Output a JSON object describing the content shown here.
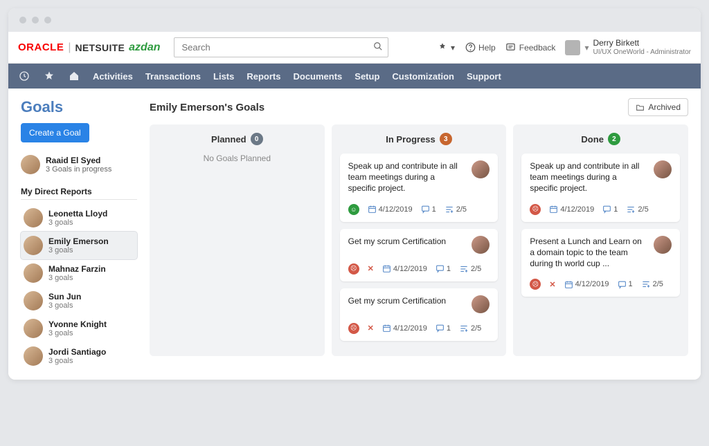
{
  "topbar": {
    "logo_oracle": "ORACLE",
    "logo_netsuite": "NETSUITE",
    "logo_azdan": "azdan",
    "search_placeholder": "Search",
    "help_label": "Help",
    "feedback_label": "Feedback",
    "user_name": "Derry Birkett",
    "user_role": "UI/UX OneWorld - Administrator"
  },
  "nav": {
    "items": [
      "Activities",
      "Transactions",
      "Lists",
      "Reports",
      "Documents",
      "Setup",
      "Customization",
      "Support"
    ]
  },
  "page": {
    "title": "Goals",
    "create_label": "Create a Goal",
    "me_name": "Raaid El Syed",
    "me_sub": "3 Goals in progress",
    "reports_header": "My Direct Reports",
    "reports": [
      {
        "name": "Leonetta Lloyd",
        "sub": "3 goals",
        "selected": false
      },
      {
        "name": "Emily Emerson",
        "sub": "3 goals",
        "selected": true
      },
      {
        "name": "Mahnaz Farzin",
        "sub": "3 goals",
        "selected": false
      },
      {
        "name": "Sun Jun",
        "sub": "3 goals",
        "selected": false
      },
      {
        "name": "Yvonne Knight",
        "sub": "3 goals",
        "selected": false
      },
      {
        "name": "Jordi Santiago",
        "sub": "3 goals",
        "selected": false
      }
    ],
    "selected_title": "Emily Emerson's Goals",
    "archived_label": "Archived"
  },
  "board": {
    "columns": [
      {
        "title": "Planned",
        "count": "0",
        "badge": "gray",
        "empty": "No Goals Planned",
        "cards": []
      },
      {
        "title": "In Progress",
        "count": "3",
        "badge": "orange",
        "cards": [
          {
            "text": "Speak up and contribute in all team meetings during a specific project.",
            "mood": "good",
            "x": false,
            "date": "4/12/2019",
            "comments": "1",
            "tasks": "2/5"
          },
          {
            "text": "Get my scrum Certification",
            "mood": "bad",
            "x": true,
            "date": "4/12/2019",
            "comments": "1",
            "tasks": "2/5"
          },
          {
            "text": "Get my scrum Certification",
            "mood": "bad",
            "x": true,
            "date": "4/12/2019",
            "comments": "1",
            "tasks": "2/5"
          }
        ]
      },
      {
        "title": "Done",
        "count": "2",
        "badge": "green",
        "cards": [
          {
            "text": "Speak up and contribute in all team meetings during a specific project.",
            "mood": "bad",
            "x": false,
            "date": "4/12/2019",
            "comments": "1",
            "tasks": "2/5"
          },
          {
            "text": "Present a Lunch and Learn on a domain topic to the team during th world cup ...",
            "mood": "bad",
            "x": true,
            "date": "4/12/2019",
            "comments": "1",
            "tasks": "2/5"
          }
        ]
      }
    ]
  }
}
